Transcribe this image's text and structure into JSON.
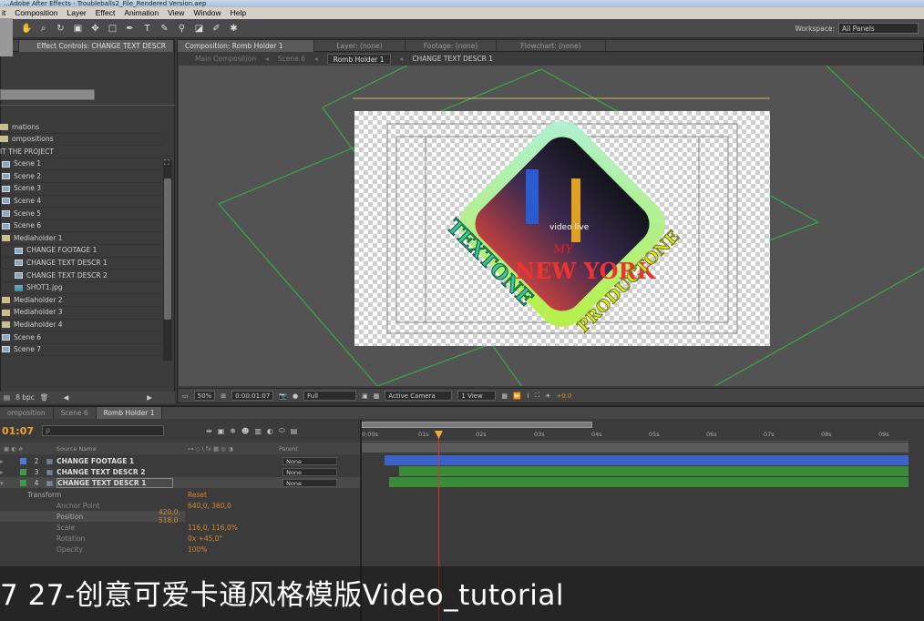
{
  "title_bar": "...Adobe After Effects - Troubleballs2_File_Rendered Version.aep",
  "menu": [
    "it",
    "Composition",
    "Layer",
    "Effect",
    "Animation",
    "View",
    "Window",
    "Help"
  ],
  "workspace": {
    "label": "Workspace:",
    "value": "All Panels"
  },
  "project_panel": {
    "tab_effects": "Effect Controls: CHANGE TEXT DESCR",
    "items": [
      {
        "label": "mations",
        "type": "folder"
      },
      {
        "label": "ompositions",
        "type": "folder"
      },
      {
        "label": "IT THE PROJECT",
        "type": "text"
      },
      {
        "label": "Scene 1",
        "type": "comp"
      },
      {
        "label": "Scene 2",
        "type": "comp"
      },
      {
        "label": "Scene 3",
        "type": "comp"
      },
      {
        "label": "Scene 4",
        "type": "comp"
      },
      {
        "label": "Scene 5",
        "type": "comp"
      },
      {
        "label": "Scene 6",
        "type": "comp"
      },
      {
        "label": "Mediaholder 1",
        "type": "folder"
      },
      {
        "label": "CHANGE FOOTAGE 1",
        "type": "comp"
      },
      {
        "label": "CHANGE TEXT DESCR 1",
        "type": "comp"
      },
      {
        "label": "CHANGE TEXT DESCR 2",
        "type": "comp"
      },
      {
        "label": "SHOT1.jpg",
        "type": "image"
      },
      {
        "label": "Mediaholder 2",
        "type": "folder"
      },
      {
        "label": "Mediaholder 3",
        "type": "folder"
      },
      {
        "label": "Mediaholder 4",
        "type": "folder"
      },
      {
        "label": "Scene 6",
        "type": "comp"
      },
      {
        "label": "Scene 7",
        "type": "comp"
      }
    ],
    "bpc": "8 bpc"
  },
  "comp_panel": {
    "tabs": [
      "Composition: Romb Holder 1",
      "Layer: (none)",
      "Footage: (none)",
      "Flowchart: (none)"
    ],
    "breadcrumb": [
      "Main Composition",
      "Scene 6",
      "Romb Holder 1",
      "CHANGE TEXT DESCR 1"
    ],
    "artwork_text": {
      "left": "TEXTONE",
      "right": "PRODUCTONE",
      "center_small": "MY",
      "center_big": "NEW YORK",
      "sign": "video live"
    },
    "footer": {
      "zoom": "50%",
      "timecode": "0:00:01:07",
      "resolution": "Full",
      "camera": "Active Camera",
      "view": "1 View",
      "exposure": "+0.0"
    }
  },
  "timeline": {
    "tabs": [
      "omposition",
      "Scene 6",
      "Romb Holder 1"
    ],
    "timecode": "01:07",
    "search_placeholder": "ρ",
    "columns": {
      "source": "Source Name",
      "parent": "Parent"
    },
    "layers": [
      {
        "num": "2",
        "name": "CHANGE FOOTAGE 1",
        "color": "#4a7bd6",
        "parent": "None"
      },
      {
        "num": "3",
        "name": "CHANGE TEXT DESCR 2",
        "color": "#3e9a4a",
        "parent": "None"
      },
      {
        "num": "4",
        "name": "CHANGE TEXT DESCR 1",
        "color": "#3e9a4a",
        "parent": "None"
      }
    ],
    "transform": {
      "label": "Transform",
      "reset": "Reset",
      "props": [
        {
          "name": "Anchor Point",
          "value": "640,0, 360,0"
        },
        {
          "name": "Position",
          "value": "420,0, 518,0"
        },
        {
          "name": "Scale",
          "value": "116,0, 116,0%"
        },
        {
          "name": "Rotation",
          "value": "0x +45,0°"
        },
        {
          "name": "Opacity",
          "value": "100%"
        }
      ]
    },
    "ruler": [
      "0:00s",
      "01s",
      "02s",
      "03s",
      "04s",
      "05s",
      "06s",
      "07s",
      "08s",
      "09s"
    ]
  },
  "caption": "7 27-创意可爱卡通风格模版Video_tutorial"
}
